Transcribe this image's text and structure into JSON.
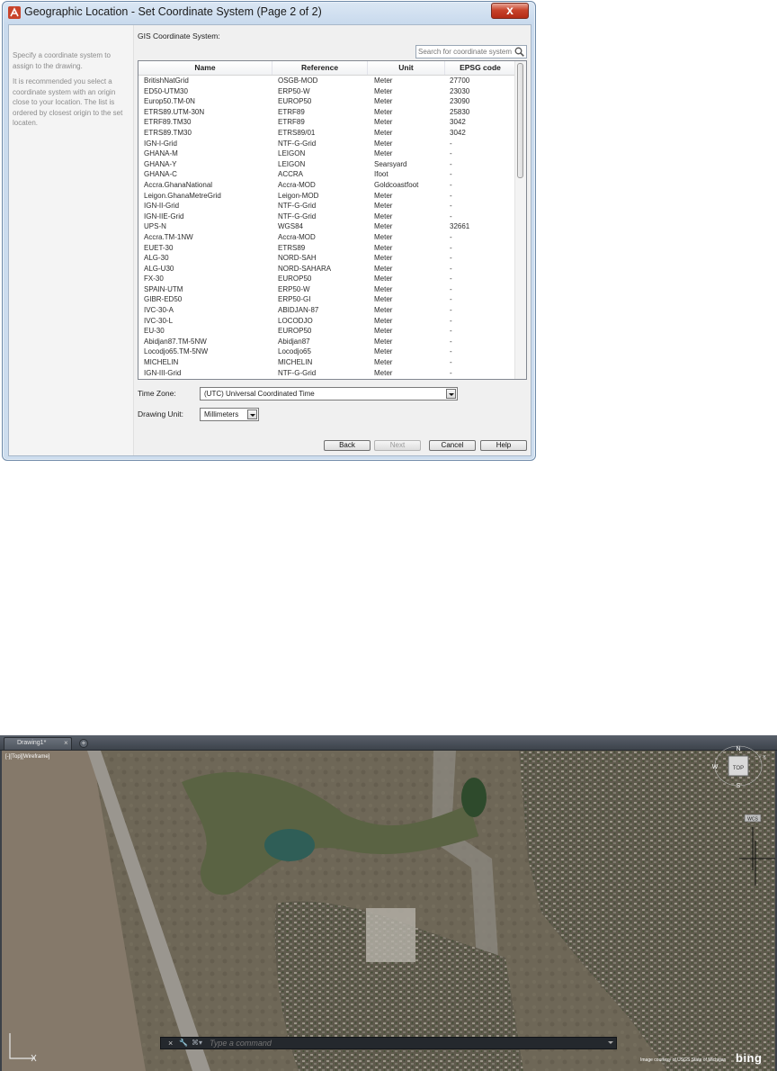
{
  "dialog": {
    "title": "Geographic Location - Set Coordinate System (Page 2 of 2)",
    "close_label": "x",
    "hint_1": "Specify a coordinate system to assign to the drawing.",
    "hint_2": "It is recommended you select a coordinate system with an origin close to your location. The list is ordered by closest origin to the set locaten.",
    "gis_label": "GIS Coordinate System:",
    "search": {
      "placeholder": "Search for coordinate system",
      "value": ""
    },
    "columns": [
      "Name",
      "Reference",
      "Unit",
      "EPSG code"
    ],
    "rows": [
      [
        "BritishNatGrid",
        "OSGB-MOD",
        "Meter",
        "27700"
      ],
      [
        "ED50-UTM30",
        "ERP50-W",
        "Meter",
        "23030"
      ],
      [
        "Europ50.TM-0N",
        "EUROP50",
        "Meter",
        "23090"
      ],
      [
        "ETRS89.UTM-30N",
        "ETRF89",
        "Meter",
        "25830"
      ],
      [
        "ETRF89.TM30",
        "ETRF89",
        "Meter",
        "3042"
      ],
      [
        "ETRS89.TM30",
        "ETRS89/01",
        "Meter",
        "3042"
      ],
      [
        "IGN-I-Grid",
        "NTF-G-Grid",
        "Meter",
        "-"
      ],
      [
        "GHANA-M",
        "LEIGON",
        "Meter",
        "-"
      ],
      [
        "GHANA-Y",
        "LEIGON",
        "Searsyard",
        "-"
      ],
      [
        "GHANA-C",
        "ACCRA",
        "Ifoot",
        "-"
      ],
      [
        "Accra.GhanaNational",
        "Accra-MOD",
        "Goldcoastfoot",
        "-"
      ],
      [
        "Leigon.GhanaMetreGrid",
        "Leigon-MOD",
        "Meter",
        "-"
      ],
      [
        "IGN-II-Grid",
        "NTF-G-Grid",
        "Meter",
        "-"
      ],
      [
        "IGN-IIE-Grid",
        "NTF-G-Grid",
        "Meter",
        "-"
      ],
      [
        "UPS-N",
        "WGS84",
        "Meter",
        "32661"
      ],
      [
        "Accra.TM-1NW",
        "Accra-MOD",
        "Meter",
        "-"
      ],
      [
        "EUET-30",
        "ETRS89",
        "Meter",
        "-"
      ],
      [
        "ALG-30",
        "NORD-SAH",
        "Meter",
        "-"
      ],
      [
        "ALG-U30",
        "NORD-SAHARA",
        "Meter",
        "-"
      ],
      [
        "FX-30",
        "EUROP50",
        "Meter",
        "-"
      ],
      [
        "SPAIN-UTM",
        "ERP50-W",
        "Meter",
        "-"
      ],
      [
        "GIBR-ED50",
        "ERP50-GI",
        "Meter",
        "-"
      ],
      [
        "IVC-30-A",
        "ABIDJAN-87",
        "Meter",
        "-"
      ],
      [
        "IVC-30-L",
        "LOCODJO",
        "Meter",
        "-"
      ],
      [
        "EU-30",
        "EUROP50",
        "Meter",
        "-"
      ],
      [
        "Abidjan87.TM-5NW",
        "Abidjan87",
        "Meter",
        "-"
      ],
      [
        "Locodjo65.TM-5NW",
        "Locodjo65",
        "Meter",
        "-"
      ],
      [
        "MICHELIN",
        "MICHELIN",
        "Meter",
        "-"
      ],
      [
        "IGN-III-Grid",
        "NTF-G-Grid",
        "Meter",
        "-"
      ]
    ],
    "time_zone": {
      "label": "Time Zone:",
      "value": "(UTC) Universal Coordinated Time"
    },
    "drawing_unit": {
      "label": "Drawing Unit:",
      "value": "Millimeters"
    },
    "buttons": {
      "back": "Back",
      "next": "Next",
      "cancel": "Cancel",
      "help": "Help"
    },
    "colors": {
      "accent_red": "#c8442b"
    }
  },
  "autocad": {
    "tab_label": "Drawing1*",
    "tab_close": "×",
    "new_tab": "+",
    "viewport_label": "[-][Top][Wireframe]",
    "window_controls": "- ▫ ×",
    "viewcube": {
      "top": "TOP",
      "n": "N",
      "s": "S",
      "w": "W",
      "wcs": "WCS"
    },
    "command": {
      "close": "×",
      "prompt_icon": "⌘▾",
      "placeholder": "Type a command"
    },
    "copyright": "Image courtesy of USGS  State of Michigan",
    "bing": "bing"
  }
}
